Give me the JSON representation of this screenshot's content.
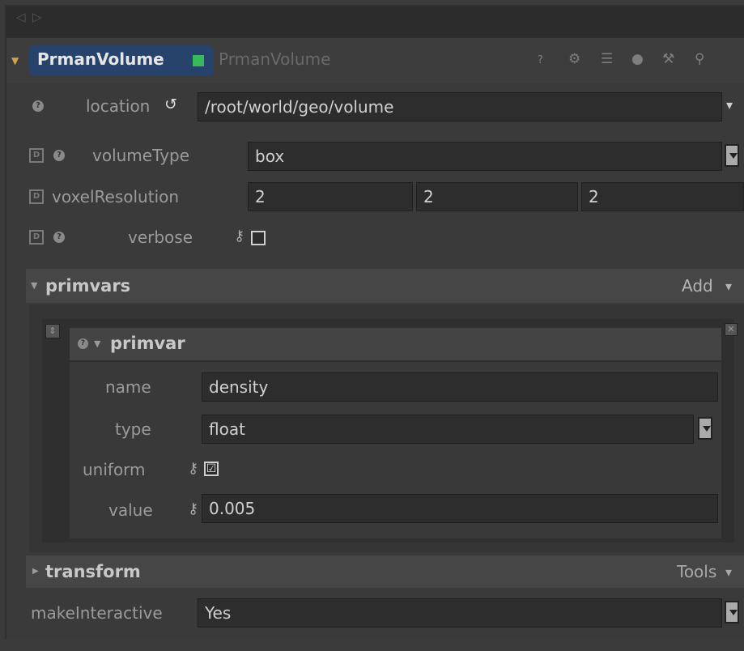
{
  "window": {
    "node_name": "PrmanVolume",
    "node_type": "PrmanVolume",
    "node_status_color": "#37b85a",
    "header_icons": [
      "help-icon",
      "gear-icon",
      "hierarchy-icon",
      "comment-icon",
      "wrench-icon",
      "search-icon"
    ]
  },
  "params": {
    "location": {
      "label": "location",
      "value": "/root/world/geo/volume"
    },
    "volumeType": {
      "label": "volumeType",
      "value": "box"
    },
    "voxelResolution": {
      "label": "voxelResolution",
      "values": [
        "2",
        "2",
        "2"
      ]
    },
    "verbose": {
      "label": "verbose",
      "checked": false
    }
  },
  "primvars": {
    "title": "primvars",
    "add_label": "Add",
    "item": {
      "title": "primvar",
      "name": {
        "label": "name",
        "value": "density"
      },
      "type": {
        "label": "type",
        "value": "float"
      },
      "uniform": {
        "label": "uniform",
        "checked": true,
        "check_glyph": "☑"
      },
      "value": {
        "label": "value",
        "value": "0.005"
      }
    }
  },
  "transform": {
    "title": "transform",
    "tools_label": "Tools"
  },
  "makeInteractive": {
    "label": "makeInteractive",
    "value": "Yes"
  },
  "glyphs": {
    "nav_back": "◁",
    "nav_forward": "▷",
    "expand_open": "▼",
    "expand_closed": "▶",
    "help": "?",
    "default": "D",
    "key": "⚷",
    "reset": "↺",
    "dropdown": "▾",
    "drag": "⇕",
    "close": "✕",
    "icons": [
      "?",
      "⚙",
      "☰",
      "●",
      "⚒",
      "⚲"
    ]
  },
  "colors": {
    "title_pill": "#27436b",
    "panel_bg": "#3a3a3a",
    "field_bg": "#2d2d2d"
  }
}
